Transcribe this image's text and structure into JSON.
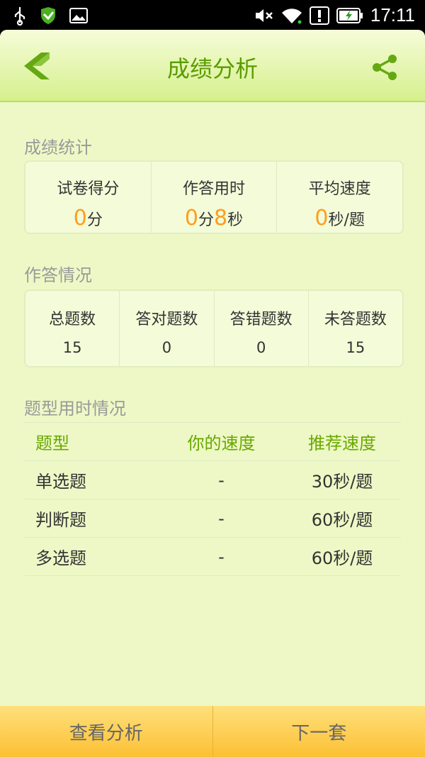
{
  "statusbar": {
    "time": "17:11"
  },
  "header": {
    "title": "成绩分析"
  },
  "stats": {
    "section_title": "成绩统计",
    "score": {
      "label": "试卷得分",
      "value": "0",
      "unit": "分"
    },
    "time_used": {
      "label": "作答用时",
      "minutes": "0",
      "min_unit": "分",
      "seconds": "8",
      "sec_unit": "秒"
    },
    "speed": {
      "label": "平均速度",
      "value": "0",
      "unit": "秒/题"
    }
  },
  "answers": {
    "section_title": "作答情况",
    "items": [
      {
        "label": "总题数",
        "value": "15"
      },
      {
        "label": "答对题数",
        "value": "0"
      },
      {
        "label": "答错题数",
        "value": "0"
      },
      {
        "label": "未答题数",
        "value": "15"
      }
    ]
  },
  "type_time": {
    "section_title": "题型用时情况",
    "headers": [
      "题型",
      "你的速度",
      "推荐速度"
    ],
    "rows": [
      [
        "单选题",
        "-",
        "30秒/题"
      ],
      [
        "判断题",
        "-",
        "60秒/题"
      ],
      [
        "多选题",
        "-",
        "60秒/题"
      ]
    ]
  },
  "bottom": {
    "analysis_label": "查看分析",
    "next_label": "下一套"
  }
}
